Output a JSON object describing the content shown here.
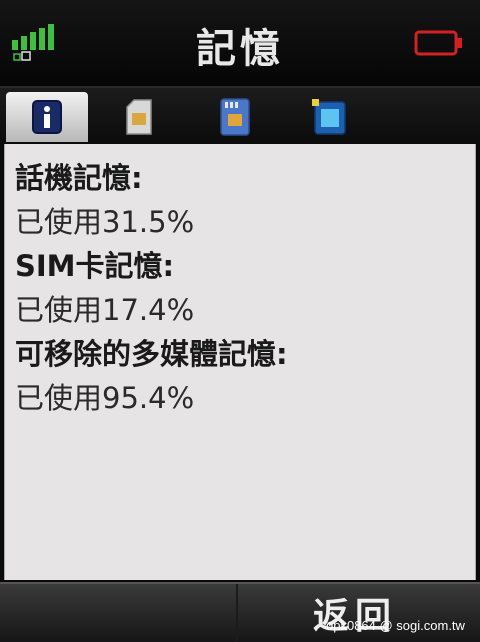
{
  "status": {
    "title": "記憶",
    "signal_icon": "signal-strength-icon",
    "battery_icon": "battery-low-icon",
    "signal_color": "#3fbf3f",
    "battery_color": "#d42020"
  },
  "tabs": [
    {
      "name": "info",
      "icon": "info-icon",
      "selected": true
    },
    {
      "name": "sim",
      "icon": "sim-card-icon",
      "selected": false
    },
    {
      "name": "memory-card",
      "icon": "memory-card-icon",
      "selected": false
    },
    {
      "name": "media",
      "icon": "media-icon",
      "selected": false
    }
  ],
  "memory": [
    {
      "label": "話機記憶:",
      "value": "已使用31.5%"
    },
    {
      "label": "SIM卡記憶:",
      "value": "已使用17.4%"
    },
    {
      "label": "可移除的多媒體記憶:",
      "value": "已使用95.4%"
    }
  ],
  "softkeys": {
    "right": "返回"
  },
  "watermark": "opk0864 @ sogi.com.tw"
}
